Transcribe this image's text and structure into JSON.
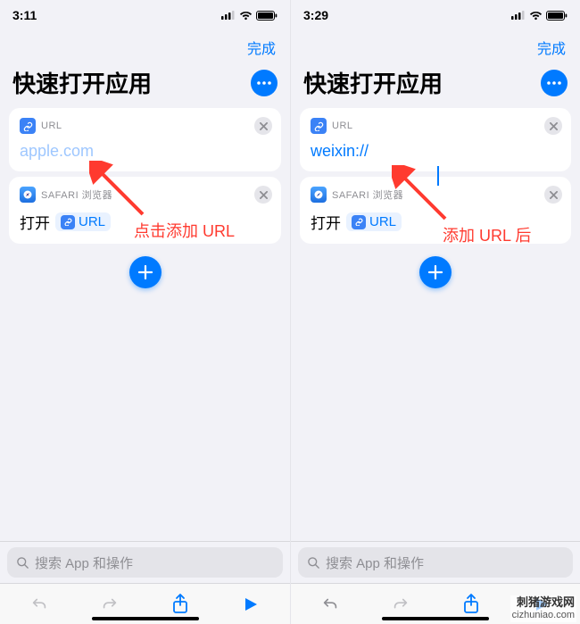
{
  "left": {
    "status_time": "3:11",
    "done": "完成",
    "title": "快速打开应用",
    "card_url_label": "URL",
    "url_value": "apple.com",
    "url_is_placeholder": true,
    "card_safari_label": "SAFARI 浏览器",
    "open_text": "打开",
    "open_chip": "URL",
    "annotation": "点击添加 URL",
    "search_placeholder": "搜索 App 和操作"
  },
  "right": {
    "status_time": "3:29",
    "done": "完成",
    "title": "快速打开应用",
    "card_url_label": "URL",
    "url_value": "weixin://",
    "url_is_placeholder": false,
    "card_safari_label": "SAFARI 浏览器",
    "open_text": "打开",
    "open_chip": "URL",
    "annotation": "添加 URL 后",
    "search_placeholder": "搜索 App 和操作"
  },
  "watermark": {
    "cn": "刺猪游戏网",
    "en": "cizhuniao.com"
  }
}
